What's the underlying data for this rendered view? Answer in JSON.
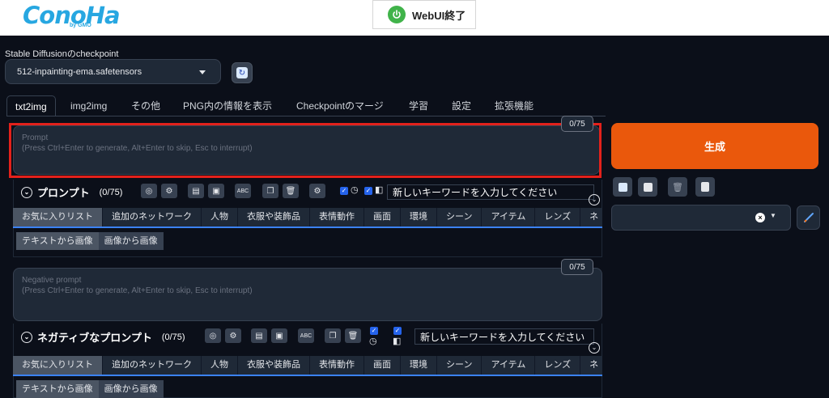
{
  "brand": {
    "logo": "ConoHa",
    "sub": "by GMO"
  },
  "header": {
    "quit_label": "WebUI終了"
  },
  "checkpoint": {
    "label": "Stable Diffusionのcheckpoint",
    "value": "512-inpainting-ema.safetensors"
  },
  "tabs": [
    "txt2img",
    "img2img",
    "その他",
    "PNG内の情報を表示",
    "Checkpointのマージ",
    "学習",
    "設定",
    "拡張機能"
  ],
  "prompt": {
    "counter": "0/75",
    "placeholder_title": "Prompt",
    "placeholder_hint": "(Press Ctrl+Enter to generate, Alt+Enter to skip, Esc to interrupt)",
    "section_title": "プロンプト",
    "section_count": "(0/75)",
    "keyword_placeholder": "新しいキーワードを入力してください"
  },
  "negative": {
    "counter": "0/75",
    "placeholder_title": "Negative prompt",
    "placeholder_hint": "(Press Ctrl+Enter to generate, Alt+Enter to skip, Esc to interrupt)",
    "section_title": "ネガティブなプロンプト",
    "section_count": "(0/75)",
    "keyword_placeholder": "新しいキーワードを入力してください"
  },
  "categories": [
    "お気に入りリスト",
    "追加のネットワーク",
    "人物",
    "衣服や装飾品",
    "表情動作",
    "画面",
    "環境",
    "シーン",
    "アイテム",
    "レンズ",
    "ネ"
  ],
  "subtabs": [
    "テキストから画像",
    "画像から画像"
  ],
  "generate_label": "生成",
  "icons": {
    "abc": "ABC"
  },
  "colors": {
    "accent": "#ea580c",
    "highlight": "#e3211b",
    "brand": "#27a7e1",
    "power": "#40b34a"
  }
}
